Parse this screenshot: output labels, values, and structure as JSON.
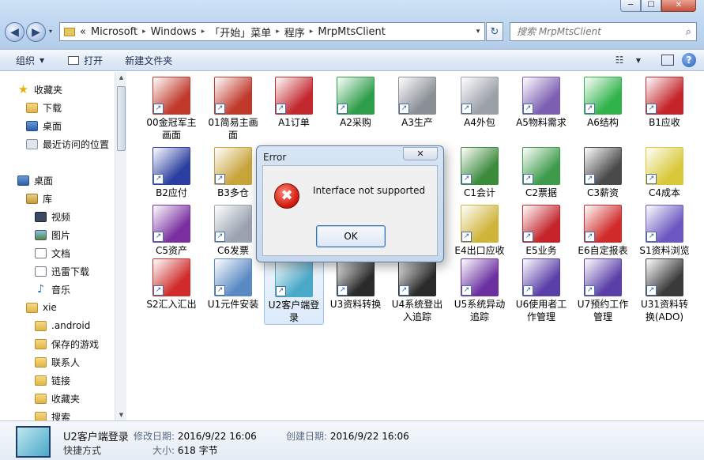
{
  "window": {
    "min_glyph": "─",
    "max_glyph": "☐",
    "close_glyph": "✕"
  },
  "nav": {
    "back_glyph": "◀",
    "forward_glyph": "▶",
    "dropdown_glyph": "▾"
  },
  "address": {
    "prefix": "«",
    "crumbs": [
      "Microsoft",
      "Windows",
      "「开始」菜单",
      "程序",
      "MrpMtsClient"
    ],
    "sep": "▸",
    "dd_glyph": "▾",
    "refresh_glyph": "↻"
  },
  "search": {
    "placeholder": "搜索 MrpMtsClient",
    "icon_glyph": "⌕"
  },
  "toolbar": {
    "organize": "组织",
    "open": "打开",
    "new_folder": "新建文件夹",
    "caret": "▼",
    "view_glyph": "☷",
    "pane_glyph": "▫",
    "help_glyph": "?"
  },
  "sidebar": {
    "favorites": "收藏夹",
    "downloads": "下载",
    "desktop": "桌面",
    "recent": "最近访问的位置",
    "desktop2": "桌面",
    "libraries": "库",
    "videos": "视频",
    "pictures": "图片",
    "documents": "文档",
    "xunlei": "迅雷下载",
    "music": "音乐",
    "user": "xie",
    "android": ".android",
    "savedgames": "保存的游戏",
    "contacts": "联系人",
    "links": "链接",
    "favorites2": "收藏夹",
    "searches": "搜索",
    "scroll_up": "▲",
    "scroll_down": "▼",
    "star_glyph": "★",
    "music_glyph": "♪"
  },
  "shortcut_glyph": "↗",
  "files": [
    {
      "label": "00金冠军主画面",
      "color": "#c0392b"
    },
    {
      "label": "01简易主画面",
      "color": "#c0392b"
    },
    {
      "label": "A1订单",
      "color": "#c3282f"
    },
    {
      "label": "A2采购",
      "color": "#2e9e4a"
    },
    {
      "label": "A3生产",
      "color": "#8a8f96"
    },
    {
      "label": "A4外包",
      "color": "#9aa0a8"
    },
    {
      "label": "A5物料需求",
      "color": "#7d5fb2"
    },
    {
      "label": "A6结构",
      "color": "#30b34a"
    },
    {
      "label": "B1应收",
      "color": "#c4242a"
    },
    {
      "label": "B2应付",
      "color": "#2b3fa0"
    },
    {
      "label": "B3多仓",
      "color": "#c9a43a"
    },
    {
      "label": "C1会计",
      "color": "#3c8a3c"
    },
    {
      "label": "C2票据",
      "color": "#3f9b4c"
    },
    {
      "label": "C3薪资",
      "color": "#4a4a4a"
    },
    {
      "label": "C4成本",
      "color": "#d9c93a"
    },
    {
      "label": "C5资产",
      "color": "#7a2fa0"
    },
    {
      "label": "C6发票",
      "color": "#9aa3b0"
    },
    {
      "label": "E4出口应收",
      "color": "#cfb43a"
    },
    {
      "label": "E5业务",
      "color": "#c4242a"
    },
    {
      "label": "E6自定报表",
      "color": "#d02a2a"
    },
    {
      "label": "S1资料浏览",
      "color": "#6b58c0"
    },
    {
      "label": "S2汇入汇出",
      "color": "#d02a2a"
    },
    {
      "label": "U1元件安装",
      "color": "#5a8ac4"
    },
    {
      "label": "U2客户端登录",
      "color": "#4aa8c8"
    },
    {
      "label": "U3资料转换",
      "color": "#2a2a2a"
    },
    {
      "label": "U4系统登出入追踪",
      "color": "#2a2a2a"
    },
    {
      "label": "U5系统异动追踪",
      "color": "#6b2fa0"
    },
    {
      "label": "U6使用者工作管理",
      "color": "#5a3fa8"
    },
    {
      "label": "U7预约工作管理",
      "color": "#5a3fa8"
    },
    {
      "label": "U31资料转换(ADO)",
      "color": "#3a3a3a"
    }
  ],
  "status": {
    "name": "U2客户端登录",
    "type": "快捷方式",
    "modified_label": "修改日期:",
    "modified_value": "2016/9/22 16:06",
    "created_label": "创建日期:",
    "created_value": "2016/9/22 16:06",
    "size_label": "大小:",
    "size_value": "618 字节"
  },
  "dialog": {
    "title": "Error",
    "close_glyph": "✕",
    "icon_glyph": "✖",
    "message": "Interface not supported",
    "ok": "OK"
  }
}
